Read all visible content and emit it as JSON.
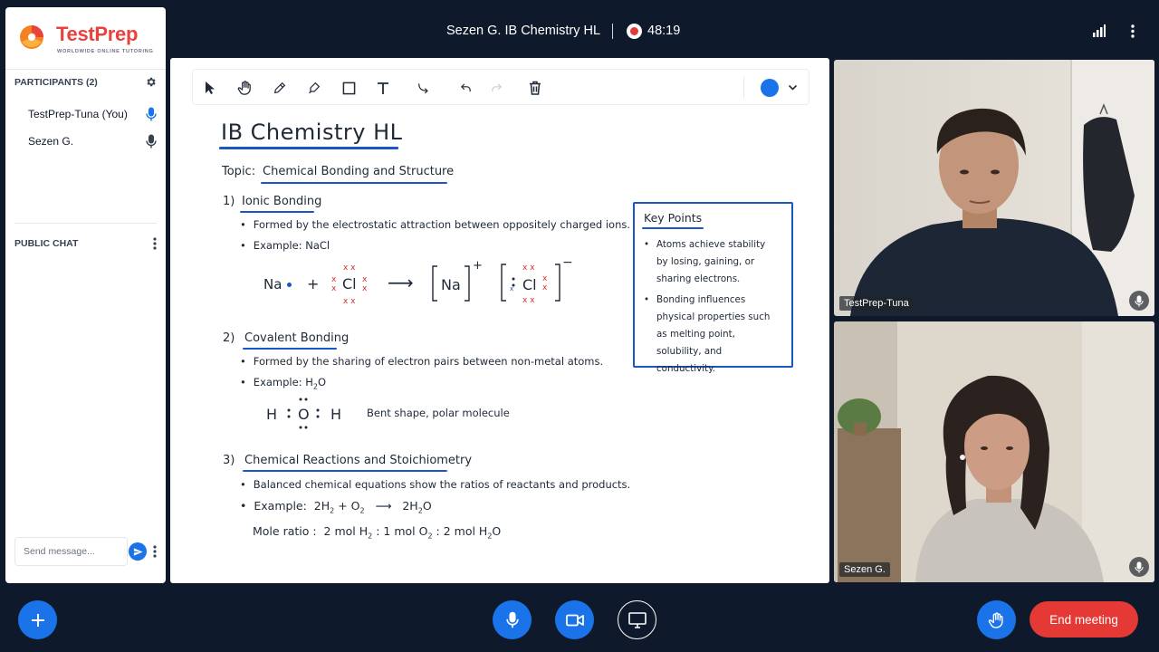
{
  "brand": {
    "name": "TestPrep",
    "tagline": "WORLDWIDE ONLINE TUTORING"
  },
  "participants": {
    "heading": "PARTICIPANTS (2)",
    "items": [
      {
        "name": "TestPrep-Tuna (You)",
        "mic_color": "#1a73e8"
      },
      {
        "name": "Sezen G.",
        "mic_color": "#374151"
      }
    ]
  },
  "chat": {
    "heading": "PUBLIC CHAT",
    "placeholder": "Send message..."
  },
  "header": {
    "title": "Sezen G. IB Chemistry HL",
    "timer": "48:19"
  },
  "whiteboard": {
    "tools": [
      "pointer-icon",
      "hand-icon",
      "pencil-icon",
      "marker-icon",
      "shape-icon",
      "text-icon",
      "connector-icon",
      "undo-icon",
      "redo-icon",
      "trash-icon"
    ],
    "pen_color": "#1a73e8",
    "title": "IB Chemistry HL",
    "topic_label": "Topic:",
    "topic": "Chemical Bonding and Structure",
    "section1": {
      "num": "1)",
      "heading": "Ionic Bonding",
      "bullet1": "Formed by the electrostatic attraction between oppositely charged ions.",
      "bullet2": "Example: NaCl",
      "na": "Na",
      "plus": "+",
      "cl": "Cl",
      "arrow": "⟶",
      "na_ion": "Na",
      "plus_charge": "+",
      "cl_ion": "Cl",
      "minus_charge": "−"
    },
    "section2": {
      "num": "2)",
      "heading": "Covalent Bonding",
      "bullet1": "Formed by the sharing of electron pairs between non-metal atoms.",
      "bullet2_prefix": "Example: H",
      "bullet2_sub": "2",
      "bullet2_suffix": "O",
      "h1": "H",
      "o": "O",
      "h2": "H",
      "note": "Bent shape, polar molecule"
    },
    "section3": {
      "num": "3)",
      "heading": "Chemical Reactions and Stoichiometry",
      "bullet1": "Balanced chemical equations show the ratios of reactants and products.",
      "example_prefix": "Example:",
      "mole_ratio_label": "Mole ratio :",
      "mole_ratio_1": "2 mol H",
      "mole_ratio_2": "1 mol O",
      "mole_ratio_3": "2 mol H",
      "sub2": "2",
      "o_tail": "O"
    },
    "key_points": {
      "title": "Key Points",
      "items": [
        "Atoms achieve stability by losing, gaining, or sharing electrons.",
        "Bonding influences physical properties such as melting point, solubility, and conductivity."
      ]
    }
  },
  "videos": [
    {
      "name": "TestPrep-Tuna"
    },
    {
      "name": "Sezen G."
    }
  ],
  "controls": {
    "end_meeting": "End meeting"
  }
}
